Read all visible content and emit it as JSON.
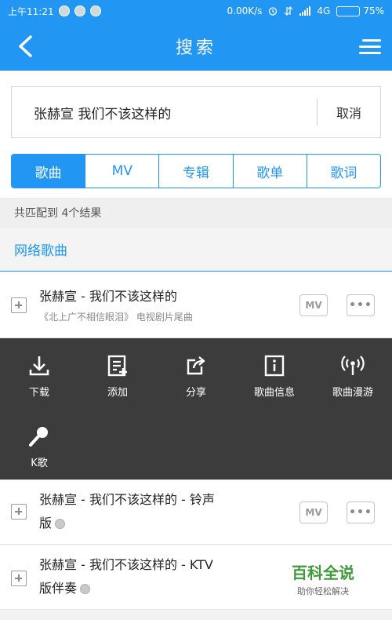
{
  "status_bar": {
    "time": "上午11:21",
    "net_speed": "0.00K/s",
    "network": "4G",
    "battery": "75%",
    "battery_level": 0.75
  },
  "header": {
    "title": "搜索"
  },
  "search": {
    "value": "张赫宣 我们不该这样的",
    "cancel_label": "取消"
  },
  "tabs": [
    {
      "label": "歌曲",
      "active": true
    },
    {
      "label": "MV",
      "active": false
    },
    {
      "label": "专辑",
      "active": false
    },
    {
      "label": "歌单",
      "active": false
    },
    {
      "label": "歌词",
      "active": false
    }
  ],
  "match_count": "共匹配到 4个结果",
  "section_title": "网络歌曲",
  "songs": [
    {
      "title": "张赫宣 - 我们不该这样的",
      "subtitle": "《北上广不相信眼泪》 电视剧片尾曲",
      "mv_label": "MV",
      "more_label": "•••"
    },
    {
      "title_line1": "张赫宣 - 我们不该这样的 - 铃声",
      "title_line2": "版",
      "mv_label": "MV",
      "more_label": "•••"
    },
    {
      "title_line1": "张赫宣 - 我们不该这样的 - KTV",
      "title_line2": "版伴奏"
    }
  ],
  "actions": [
    {
      "label": "下载",
      "icon": "download-icon"
    },
    {
      "label": "添加",
      "icon": "add-to-list-icon"
    },
    {
      "label": "分享",
      "icon": "share-icon"
    },
    {
      "label": "歌曲信息",
      "icon": "info-icon"
    },
    {
      "label": "歌曲漫游",
      "icon": "broadcast-icon"
    },
    {
      "label": "K歌",
      "icon": "microphone-icon"
    }
  ],
  "watermark": {
    "title": "百科全说",
    "subtitle": "助你轻松解决"
  },
  "colors": {
    "accent": "#2196f3",
    "panel": "#3c3c3c",
    "watermark_green": "#3f9a3a"
  }
}
